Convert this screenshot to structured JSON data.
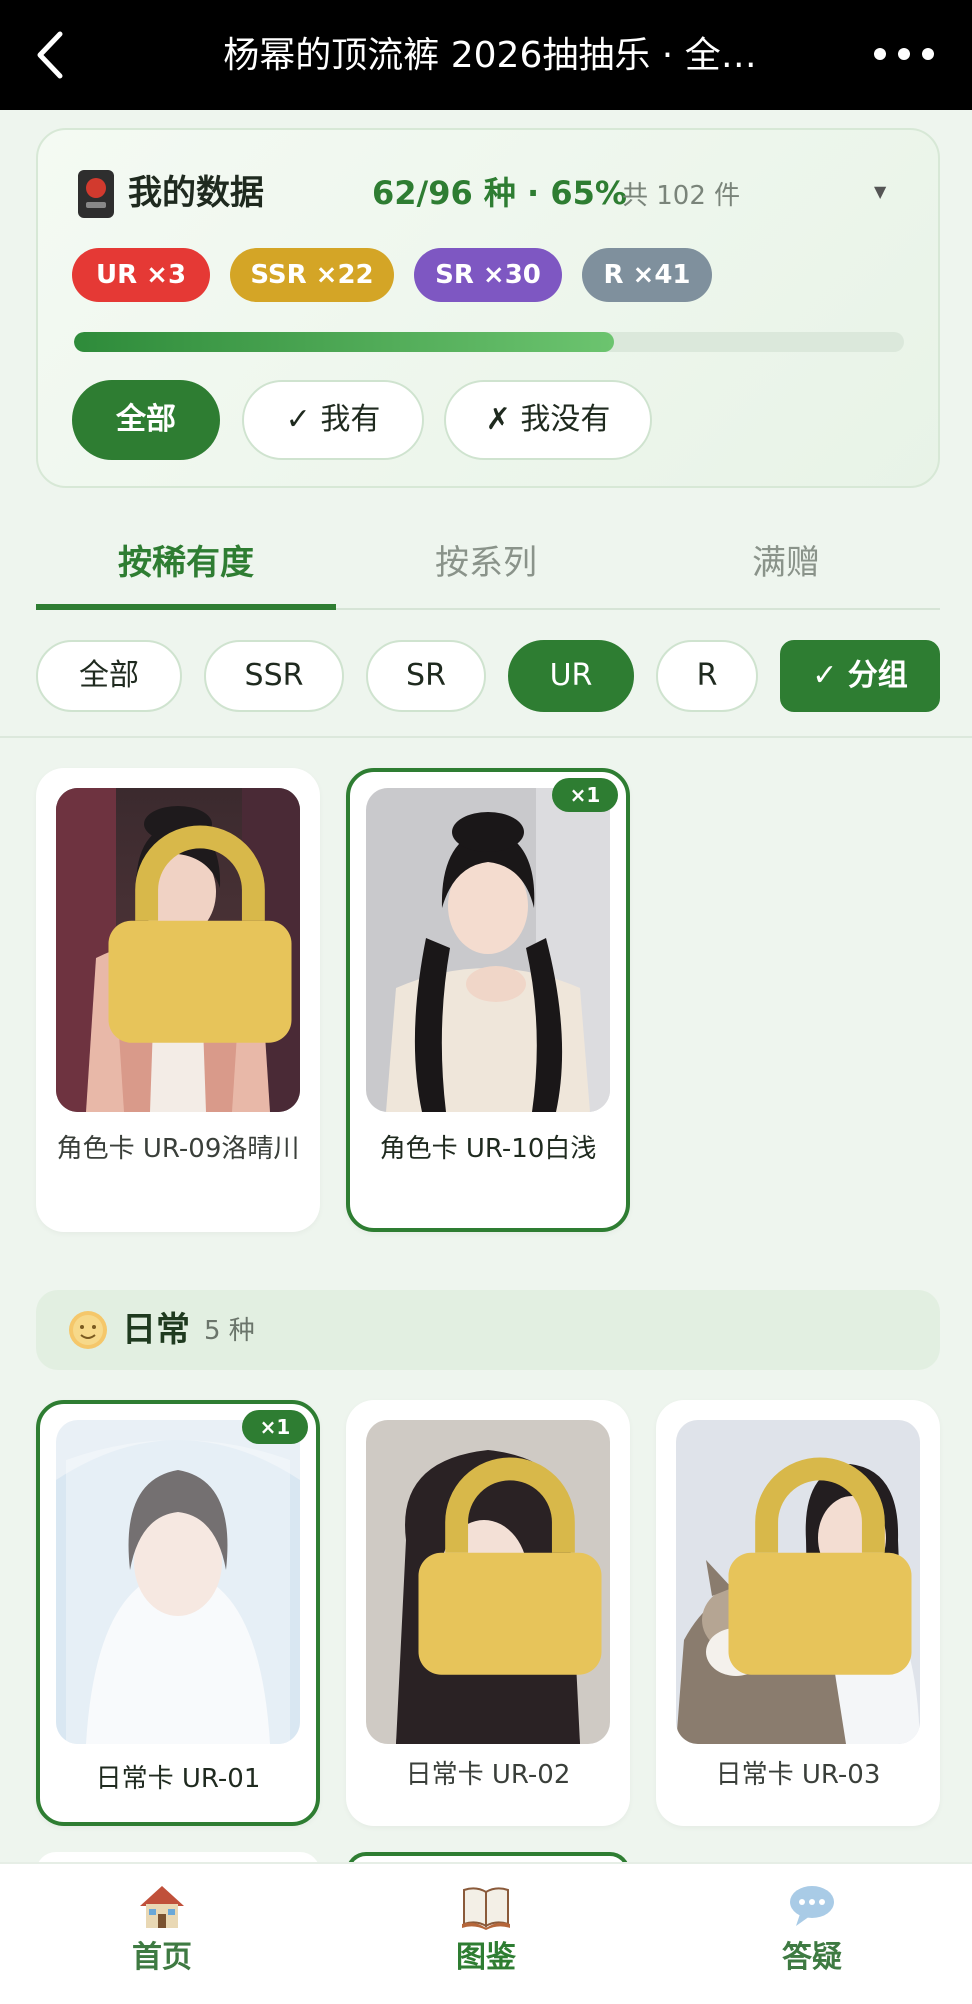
{
  "header": {
    "title": "杨幂的顶流裤 2026抽抽乐 · 全…",
    "back_icon": "chevron-left-icon",
    "more_icon": "more-dots-icon"
  },
  "my_data": {
    "title": "我的数据",
    "stats": "62/96 种 · 65%",
    "total": "共 102 件",
    "progress_fraction": 0.65,
    "badges": [
      {
        "label": "UR ×3",
        "color": "#e53935"
      },
      {
        "label": "SSR ×22",
        "color": "#d4a526"
      },
      {
        "label": "SR ×30",
        "color": "#7e57c2"
      },
      {
        "label": "R ×41",
        "color": "#7f909d"
      }
    ],
    "filters": [
      "全部",
      "✓ 我有",
      "✗ 我没有"
    ]
  },
  "tabs": [
    "按稀有度",
    "按系列",
    "满赠"
  ],
  "rarity_chips": [
    "全部",
    "SSR",
    "SR",
    "UR",
    "R",
    "✓ 分组"
  ],
  "cards_top": [
    {
      "name": "角色卡 UR-09洛晴川",
      "owned": false
    },
    {
      "name": "角色卡 UR-10白浅",
      "owned": true,
      "count": "×1"
    }
  ],
  "section": {
    "title": "日常",
    "count": "5 种"
  },
  "cards_daily": [
    {
      "name": "日常卡 UR-01",
      "owned": true,
      "count": "×1"
    },
    {
      "name": "日常卡 UR-02",
      "owned": false
    },
    {
      "name": "日常卡 UR-03",
      "owned": false
    }
  ],
  "bottom_nav": [
    {
      "label": "首页",
      "icon": "house-icon"
    },
    {
      "label": "图鉴",
      "icon": "book-icon"
    },
    {
      "label": "答疑",
      "icon": "chat-bubble-icon"
    }
  ]
}
